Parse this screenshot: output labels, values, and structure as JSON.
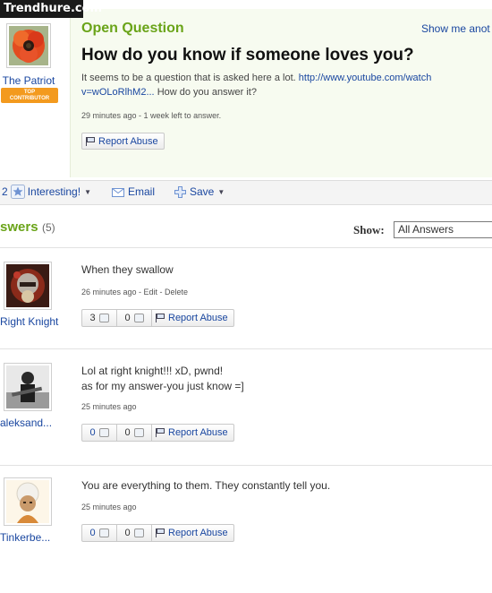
{
  "watermark": "Trendhure.com",
  "question": {
    "label": "Open Question",
    "show_more": "Show me anot",
    "title": "How do you know if someone loves you?",
    "body_line1": "It seems to be a question that is asked here a lot.",
    "body_link1": "http://www.youtube.com/watch",
    "body_link2": "v=wOLoRlhM2...",
    "body_tail": "How do you answer it?",
    "meta": "29 minutes ago - 1 week left to answer.",
    "report": "Report Abuse",
    "asker_name": "The Patriot",
    "badge_line1": "TOP",
    "badge_line2": "CONTRIBUTOR"
  },
  "toolbar": {
    "interesting_count": "2",
    "interesting_label": "Interesting!",
    "email_label": "Email",
    "save_label": "Save"
  },
  "answers_header": {
    "title": "swers",
    "count": "(5)",
    "show_label": "Show:",
    "select_value": "All Answers"
  },
  "answers": [
    {
      "author": "Right Knight",
      "text_line1": "When they swallow",
      "text_line2": "",
      "meta": "26 minutes ago - Edit - Delete",
      "up": "3",
      "down": "0",
      "report": "Report Abuse"
    },
    {
      "author": "aleksand...",
      "text_line1": "Lol at right knight!!! xD, pwnd!",
      "text_line2": "as for my answer-you just know =]",
      "meta": "25 minutes ago",
      "up": "0",
      "down": "0",
      "report": "Report Abuse"
    },
    {
      "author": "Tinkerbe...",
      "text_line1": "You are everything to them. They constantly tell you.",
      "text_line2": "",
      "meta": "25 minutes ago",
      "up": "0",
      "down": "0",
      "report": "Report Abuse"
    }
  ],
  "colors": {
    "label_green": "#6aa419",
    "link_blue": "#1a47a0",
    "badge_orange": "#f39a1e"
  }
}
